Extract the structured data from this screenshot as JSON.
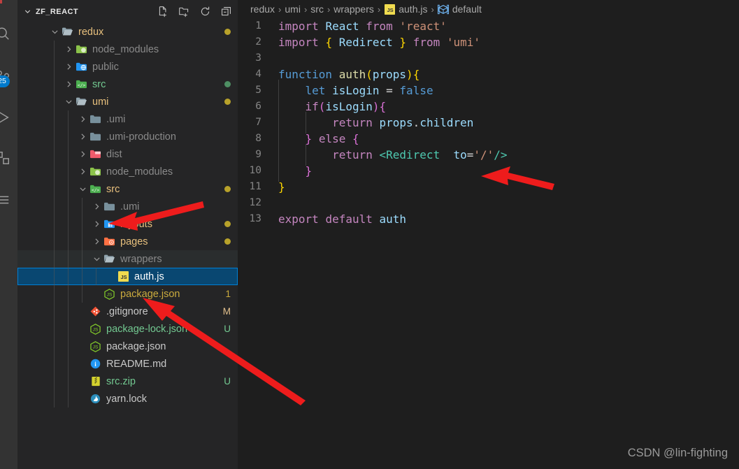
{
  "activity_bar": {
    "badge": "25",
    "icons": [
      {
        "name": "search-icon"
      },
      {
        "name": "source-control-icon"
      },
      {
        "name": "run-debug-icon"
      },
      {
        "name": "extensions-icon"
      },
      {
        "name": "remote-explorer-icon"
      }
    ]
  },
  "explorer": {
    "title": "ZF_REACT",
    "actions": [
      {
        "name": "new-file-icon",
        "tooltip": "New File"
      },
      {
        "name": "new-folder-icon",
        "tooltip": "New Folder"
      },
      {
        "name": "refresh-icon",
        "tooltip": "Refresh Explorer"
      },
      {
        "name": "collapse-all-icon",
        "tooltip": "Collapse Folders in Explorer"
      }
    ],
    "tree": [
      {
        "label": "redux",
        "depth": 0,
        "type": "folder",
        "state": "expanded",
        "icon": "folder-open-icon",
        "color": "#e8c07d",
        "dot": "#b8a22a"
      },
      {
        "label": "node_modules",
        "depth": 1,
        "type": "folder",
        "state": "collapsed",
        "icon": "folder-node-icon",
        "color": "#8a8a8a",
        "dot": ""
      },
      {
        "label": "public",
        "depth": 1,
        "type": "folder",
        "state": "collapsed",
        "icon": "folder-public-icon",
        "color": "#8a8a8a",
        "dot": ""
      },
      {
        "label": "src",
        "depth": 1,
        "type": "folder",
        "state": "collapsed",
        "icon": "folder-src-icon",
        "color": "#73c991",
        "dot": "#4e8f63"
      },
      {
        "label": "umi",
        "depth": 1,
        "type": "folder",
        "state": "expanded",
        "icon": "folder-open-icon",
        "color": "#e8c07d",
        "dot": "#b8a22a"
      },
      {
        "label": ".umi",
        "depth": 2,
        "type": "folder",
        "state": "collapsed",
        "icon": "folder-icon",
        "color": "#8a8a8a",
        "dot": ""
      },
      {
        "label": ".umi-production",
        "depth": 2,
        "type": "folder",
        "state": "collapsed",
        "icon": "folder-icon",
        "color": "#8a8a8a",
        "dot": ""
      },
      {
        "label": "dist",
        "depth": 2,
        "type": "folder",
        "state": "collapsed",
        "icon": "folder-dist-icon",
        "color": "#8a8a8a",
        "dot": ""
      },
      {
        "label": "node_modules",
        "depth": 2,
        "type": "folder",
        "state": "collapsed",
        "icon": "folder-node-icon",
        "color": "#8a8a8a",
        "dot": ""
      },
      {
        "label": "src",
        "depth": 2,
        "type": "folder",
        "state": "expanded",
        "icon": "folder-src-icon",
        "color": "#e8c07d",
        "dot": "#b8a22a"
      },
      {
        "label": ".umi",
        "depth": 3,
        "type": "folder",
        "state": "collapsed",
        "icon": "folder-icon",
        "color": "#8a8a8a",
        "dot": ""
      },
      {
        "label": "layouts",
        "depth": 3,
        "type": "folder",
        "state": "collapsed",
        "icon": "folder-layouts-icon",
        "color": "#e8c07d",
        "dot": "#b8a22a"
      },
      {
        "label": "pages",
        "depth": 3,
        "type": "folder",
        "state": "collapsed",
        "icon": "folder-pages-icon",
        "color": "#e8c07d",
        "dot": "#b8a22a"
      },
      {
        "label": "wrappers",
        "depth": 3,
        "type": "folder",
        "state": "expanded",
        "icon": "folder-open-icon",
        "color": "#8a8a8a",
        "dot": "",
        "hover": true
      },
      {
        "label": "auth.js",
        "depth": 4,
        "type": "file",
        "state": "",
        "icon": "js-file-icon",
        "color": "#ffffff",
        "selected": true
      },
      {
        "label": "package.json",
        "depth": 3,
        "type": "file",
        "state": "",
        "icon": "nodejs-file-icon",
        "color": "#cbab3e",
        "badge": "1",
        "badge_color": "#cbab3e"
      },
      {
        "label": ".gitignore",
        "depth": 2,
        "type": "file",
        "state": "",
        "icon": "git-file-icon",
        "color": "#c9c9c9",
        "badge": "M",
        "badge_color": "#e2c08d"
      },
      {
        "label": "package-lock.json",
        "depth": 2,
        "type": "file",
        "state": "",
        "icon": "nodejs-file-icon",
        "color": "#73c991",
        "badge": "U",
        "badge_color": "#73c991"
      },
      {
        "label": "package.json",
        "depth": 2,
        "type": "file",
        "state": "",
        "icon": "nodejs-file-icon",
        "color": "#c9c9c9",
        "badge": ""
      },
      {
        "label": "README.md",
        "depth": 2,
        "type": "file",
        "state": "",
        "icon": "info-file-icon",
        "color": "#c9c9c9",
        "badge": ""
      },
      {
        "label": "src.zip",
        "depth": 2,
        "type": "file",
        "state": "",
        "icon": "zip-file-icon",
        "color": "#73c991",
        "badge": "U",
        "badge_color": "#73c991"
      },
      {
        "label": "yarn.lock",
        "depth": 2,
        "type": "file",
        "state": "",
        "icon": "yarn-file-icon",
        "color": "#c9c9c9",
        "badge": ""
      }
    ]
  },
  "breadcrumb": {
    "items": [
      {
        "label": "redux",
        "icon": ""
      },
      {
        "label": "umi",
        "icon": ""
      },
      {
        "label": "src",
        "icon": ""
      },
      {
        "label": "wrappers",
        "icon": ""
      },
      {
        "label": "auth.js",
        "icon": "js-file-icon"
      },
      {
        "label": "default",
        "icon": "symbol-object-icon"
      }
    ],
    "separator": "›"
  },
  "editor": {
    "lines": [
      {
        "num": "1",
        "indent": 0,
        "tokens": [
          {
            "t": "import",
            "c": "t-kw"
          },
          {
            "t": " ",
            "c": "t-plain"
          },
          {
            "t": "React",
            "c": "t-var"
          },
          {
            "t": " ",
            "c": "t-plain"
          },
          {
            "t": "from",
            "c": "t-kw"
          },
          {
            "t": " ",
            "c": "t-plain"
          },
          {
            "t": "'react'",
            "c": "t-str"
          }
        ]
      },
      {
        "num": "2",
        "indent": 0,
        "tokens": [
          {
            "t": "import",
            "c": "t-kw"
          },
          {
            "t": " ",
            "c": "t-plain"
          },
          {
            "t": "{",
            "c": "t-p1"
          },
          {
            "t": " ",
            "c": "t-plain"
          },
          {
            "t": "Redirect",
            "c": "t-var"
          },
          {
            "t": " ",
            "c": "t-plain"
          },
          {
            "t": "}",
            "c": "t-p1"
          },
          {
            "t": " ",
            "c": "t-plain"
          },
          {
            "t": "from",
            "c": "t-kw"
          },
          {
            "t": " ",
            "c": "t-plain"
          },
          {
            "t": "'umi'",
            "c": "t-str"
          }
        ]
      },
      {
        "num": "3",
        "indent": 0,
        "tokens": []
      },
      {
        "num": "4",
        "indent": 0,
        "tokens": [
          {
            "t": "function",
            "c": "t-kw2"
          },
          {
            "t": " ",
            "c": "t-plain"
          },
          {
            "t": "auth",
            "c": "t-fn"
          },
          {
            "t": "(",
            "c": "t-p1"
          },
          {
            "t": "props",
            "c": "t-var"
          },
          {
            "t": ")",
            "c": "t-p1"
          },
          {
            "t": "{",
            "c": "t-p1"
          }
        ]
      },
      {
        "num": "5",
        "indent": 1,
        "tokens": [
          {
            "t": "let",
            "c": "t-kw2"
          },
          {
            "t": " ",
            "c": "t-plain"
          },
          {
            "t": "isLogin",
            "c": "t-var"
          },
          {
            "t": " = ",
            "c": "t-plain"
          },
          {
            "t": "false",
            "c": "t-kw2"
          }
        ]
      },
      {
        "num": "6",
        "indent": 1,
        "tokens": [
          {
            "t": "if",
            "c": "t-kw"
          },
          {
            "t": "(",
            "c": "t-p2"
          },
          {
            "t": "isLogin",
            "c": "t-var"
          },
          {
            "t": ")",
            "c": "t-p2"
          },
          {
            "t": "{",
            "c": "t-p2"
          }
        ]
      },
      {
        "num": "7",
        "indent": 2,
        "tokens": [
          {
            "t": "return",
            "c": "t-kw"
          },
          {
            "t": " ",
            "c": "t-plain"
          },
          {
            "t": "props",
            "c": "t-var"
          },
          {
            "t": ".",
            "c": "t-plain"
          },
          {
            "t": "children",
            "c": "t-var"
          }
        ]
      },
      {
        "num": "8",
        "indent": 1,
        "tokens": [
          {
            "t": "}",
            "c": "t-p2"
          },
          {
            "t": " ",
            "c": "t-plain"
          },
          {
            "t": "else",
            "c": "t-kw"
          },
          {
            "t": " ",
            "c": "t-plain"
          },
          {
            "t": "{",
            "c": "t-p2"
          }
        ]
      },
      {
        "num": "9",
        "indent": 2,
        "tokens": [
          {
            "t": "return",
            "c": "t-kw"
          },
          {
            "t": " ",
            "c": "t-plain"
          },
          {
            "t": "<Redirect",
            "c": "t-tag"
          },
          {
            "t": "  ",
            "c": "t-plain"
          },
          {
            "t": "to",
            "c": "t-var"
          },
          {
            "t": "=",
            "c": "t-plain"
          },
          {
            "t": "'/'",
            "c": "t-str"
          },
          {
            "t": "/>",
            "c": "t-tag"
          }
        ]
      },
      {
        "num": "10",
        "indent": 1,
        "tokens": [
          {
            "t": "}",
            "c": "t-p2"
          }
        ]
      },
      {
        "num": "11",
        "indent": 0,
        "tokens": [
          {
            "t": "}",
            "c": "t-p1"
          }
        ]
      },
      {
        "num": "12",
        "indent": 0,
        "tokens": []
      },
      {
        "num": "13",
        "indent": 0,
        "tokens": [
          {
            "t": "export",
            "c": "t-kw"
          },
          {
            "t": " ",
            "c": "t-plain"
          },
          {
            "t": "default",
            "c": "t-kw"
          },
          {
            "t": " ",
            "c": "t-plain"
          },
          {
            "t": "auth",
            "c": "t-var"
          }
        ]
      }
    ]
  },
  "annotations": {
    "arrow_color": "#ee1c1c",
    "arrows": [
      {
        "name": "arrow-to-src-folder"
      },
      {
        "name": "arrow-to-authjs-file"
      },
      {
        "name": "arrow-to-redirect-line"
      }
    ]
  },
  "watermark": "CSDN @lin-fighting"
}
